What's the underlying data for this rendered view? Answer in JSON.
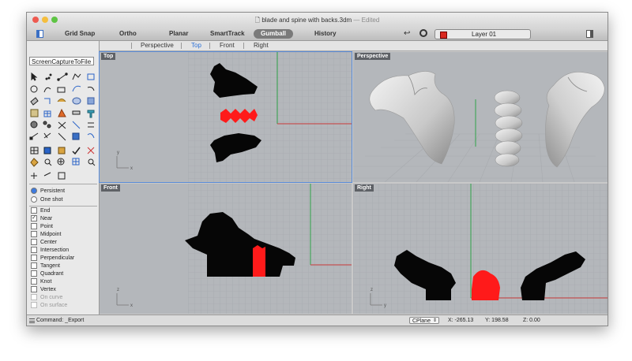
{
  "window": {
    "title": "blade and spine with backs.3dm",
    "edited": "— Edited"
  },
  "toolbar": {
    "items": [
      "Grid Snap",
      "Ortho",
      "Planar",
      "SmartTrack",
      "Gumball",
      "History"
    ],
    "active": "Gumball",
    "layer": "Layer 01",
    "layer_color": "#d9281f"
  },
  "viewport_tabs": {
    "items": [
      "Perspective",
      "Top",
      "Front",
      "Right"
    ],
    "active": "Top"
  },
  "command_input": "ScreenCaptureToFile",
  "osnap": {
    "modes": [
      {
        "label": "Persistent",
        "selected": true
      },
      {
        "label": "One shot",
        "selected": false
      }
    ],
    "items": [
      {
        "label": "End",
        "checked": false,
        "enabled": true
      },
      {
        "label": "Near",
        "checked": true,
        "enabled": true
      },
      {
        "label": "Point",
        "checked": false,
        "enabled": true
      },
      {
        "label": "Midpoint",
        "checked": false,
        "enabled": true
      },
      {
        "label": "Center",
        "checked": false,
        "enabled": true
      },
      {
        "label": "Intersection",
        "checked": false,
        "enabled": true
      },
      {
        "label": "Perpendicular",
        "checked": false,
        "enabled": true
      },
      {
        "label": "Tangent",
        "checked": false,
        "enabled": true
      },
      {
        "label": "Quadrant",
        "checked": false,
        "enabled": true
      },
      {
        "label": "Knot",
        "checked": false,
        "enabled": true
      },
      {
        "label": "Vertex",
        "checked": false,
        "enabled": true
      },
      {
        "label": "On curve",
        "checked": false,
        "enabled": false
      },
      {
        "label": "On surface",
        "checked": false,
        "enabled": false
      }
    ]
  },
  "viewports": {
    "top": {
      "label": "Top",
      "axis_x": "x",
      "axis_y": "y"
    },
    "perspective": {
      "label": "Perspective",
      "axis_x": "x",
      "axis_y": "y"
    },
    "front": {
      "label": "Front",
      "axis_x": "x",
      "axis_y": "z"
    },
    "right": {
      "label": "Right",
      "axis_x": "y",
      "axis_y": "z"
    }
  },
  "status": {
    "command": "Command: _Export",
    "cplane": "CPlane",
    "x": "X: -265.13",
    "y": "Y: 198.58",
    "z": "Z: 0.00"
  },
  "colors": {
    "selection": "#ff1a1a",
    "x_axis": "#c83a3a",
    "y_axis": "#2fa34a",
    "viewport_bg": "#b4b7bb"
  }
}
